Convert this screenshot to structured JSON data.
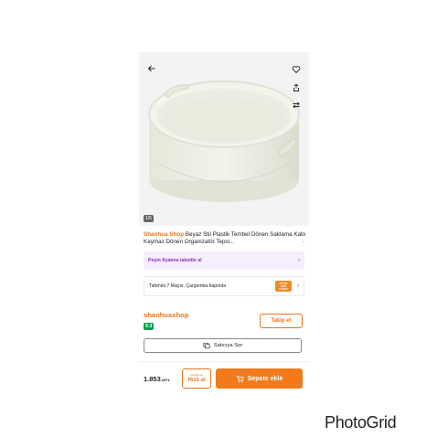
{
  "gallery": {
    "image_counter": "1/5",
    "icons": {
      "back": "arrow-left-icon",
      "favorite": "heart-icon",
      "share": "share-icon",
      "compare": "swap-icon"
    }
  },
  "product": {
    "brand": "Shanhua Shop",
    "title": "Beyaz Stil Plastik Tembel Dönen Saklama Kabı Kaymaz Dönen Organizatör Tepsi..."
  },
  "installment": {
    "label": "Peşin fiyatına taksitle al"
  },
  "delivery": {
    "label": "Tahmini 7 Mayıs, Çarşamba kapında",
    "badge_text": "SÜPER HIZLI KARGO"
  },
  "seller": {
    "name": "shanhuashop",
    "score": "9.3",
    "follow_label": "Takip et"
  },
  "ask_seller": {
    "label": "Satıcıya Sor"
  },
  "bottom_bar": {
    "price": "1.853",
    "price_suffix": ",28TL",
    "quick_buy_top": "hepsijet ile",
    "quick_buy_label": "Hızlı al",
    "cart_label": "Sepete ekle"
  },
  "watermark": "PhotoGrid",
  "colors": {
    "accent": "#f27a1a",
    "brand_text": "#e8761b",
    "installment_text": "#8f2fbf",
    "score_bg": "#0e9c4b"
  }
}
